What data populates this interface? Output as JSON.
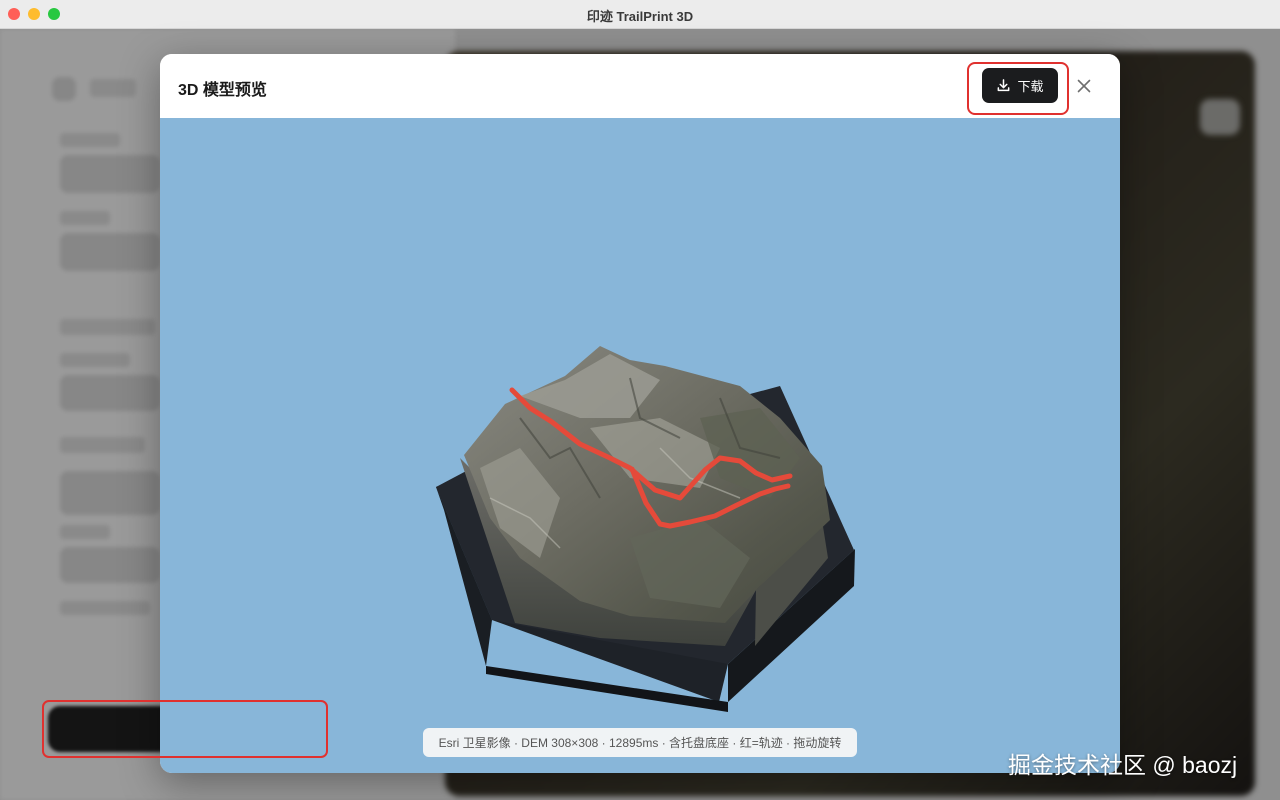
{
  "window": {
    "title": "印迹 TrailPrint 3D"
  },
  "modal": {
    "title": "3D 模型预览",
    "download_label": "下载",
    "download_icon": "download-icon",
    "close_icon": "close-icon"
  },
  "viewport": {
    "background_color": "#88b6d9",
    "track_color": "#e54a3a",
    "base_color": "#1f2329"
  },
  "info_bar": {
    "text": "Esri 卫星影像 · DEM 308×308 · 12895ms · 含托盘底座 · 红=轨迹 · 拖动旋转"
  },
  "watermark": {
    "text": "掘金技术社区 @ baozj"
  },
  "colors": {
    "highlight": "#e0312f",
    "primary_button": "#1b1c1e"
  }
}
